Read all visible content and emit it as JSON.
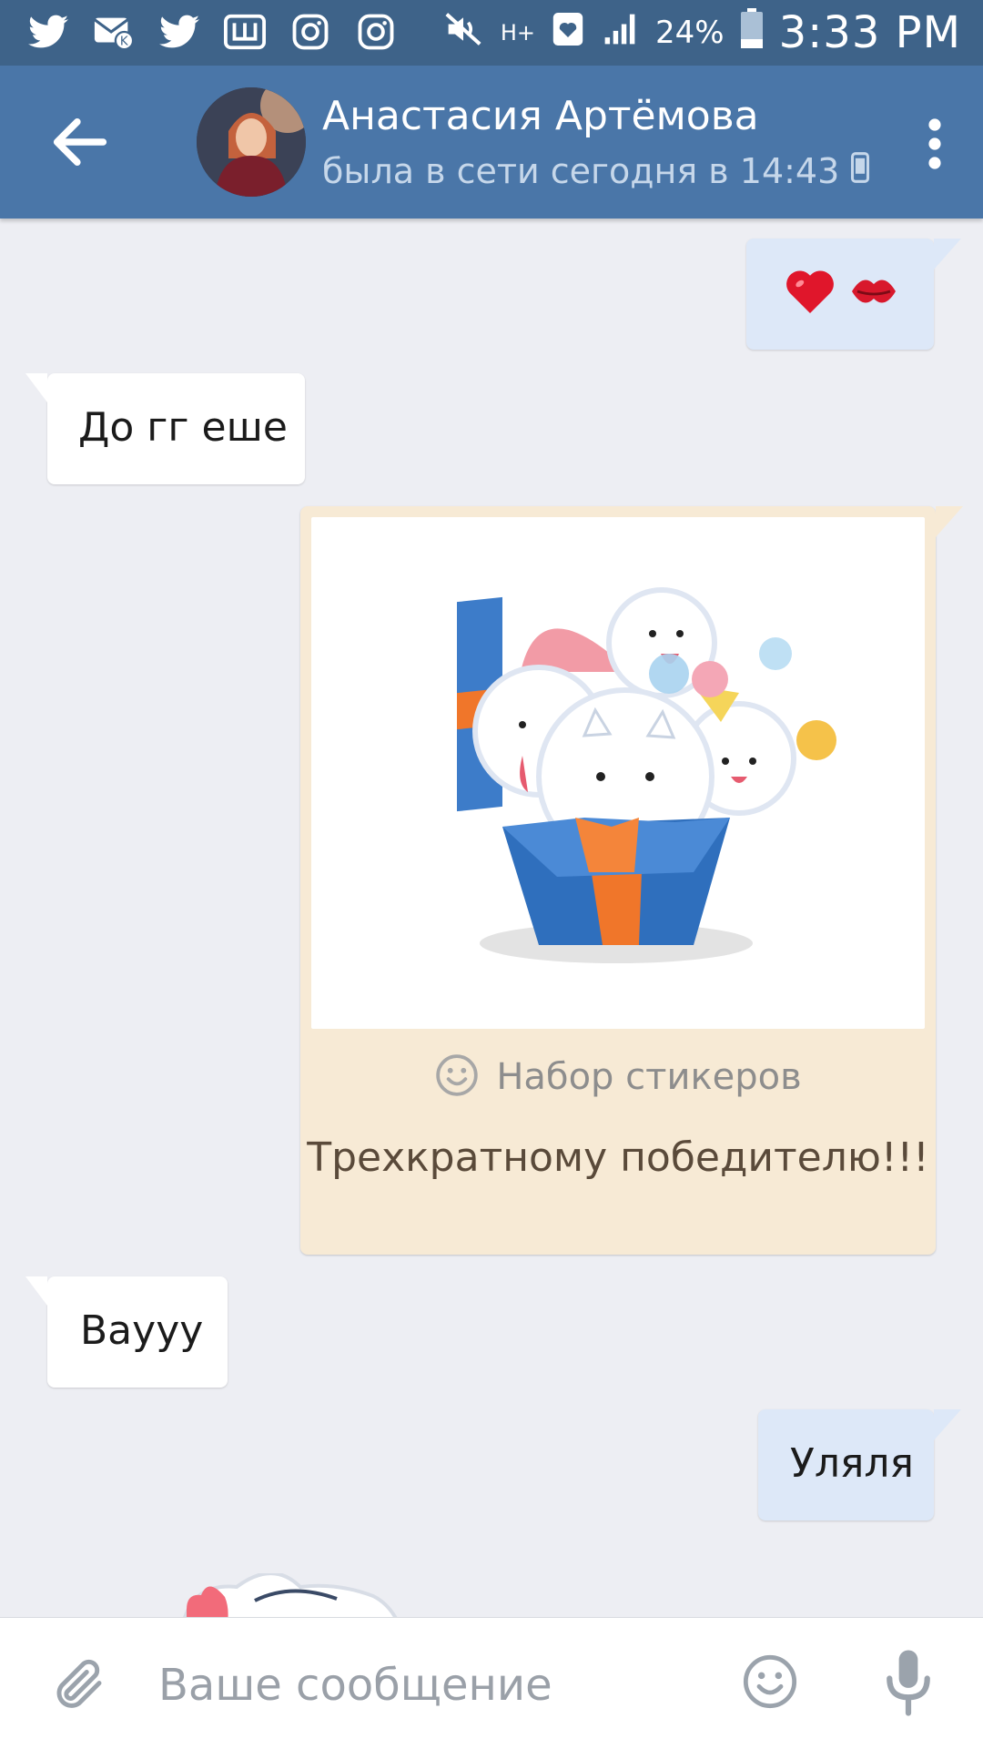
{
  "status_bar": {
    "notifications": [
      "twitter-icon",
      "vk-mail-icon",
      "twitter-icon",
      "shazam-icon",
      "instagram-icon",
      "instagram-icon"
    ],
    "network": "H+",
    "battery": "24%",
    "time": "3:33 PM"
  },
  "header": {
    "name": "Анастасия Артёмова",
    "last_seen": "была в сети сегодня в 14:43"
  },
  "messages": [
    {
      "side": "out",
      "content": "❤️💋"
    },
    {
      "side": "in",
      "content": "До гг еше"
    },
    {
      "side": "out",
      "type": "gift",
      "label": "Набор стикеров",
      "caption": "Трехкратному победителю!!!"
    },
    {
      "side": "in",
      "content": "Вауyy"
    },
    {
      "side": "out",
      "content": "Уляля"
    }
  ],
  "composer": {
    "placeholder": "Ваше сообщение"
  },
  "colors": {
    "header": "#4a76a8",
    "status_bar": "#3e6389",
    "chat_bg": "#edeef3",
    "out_bubble": "#dde8f8",
    "gift_bubble": "#f7ead5"
  }
}
